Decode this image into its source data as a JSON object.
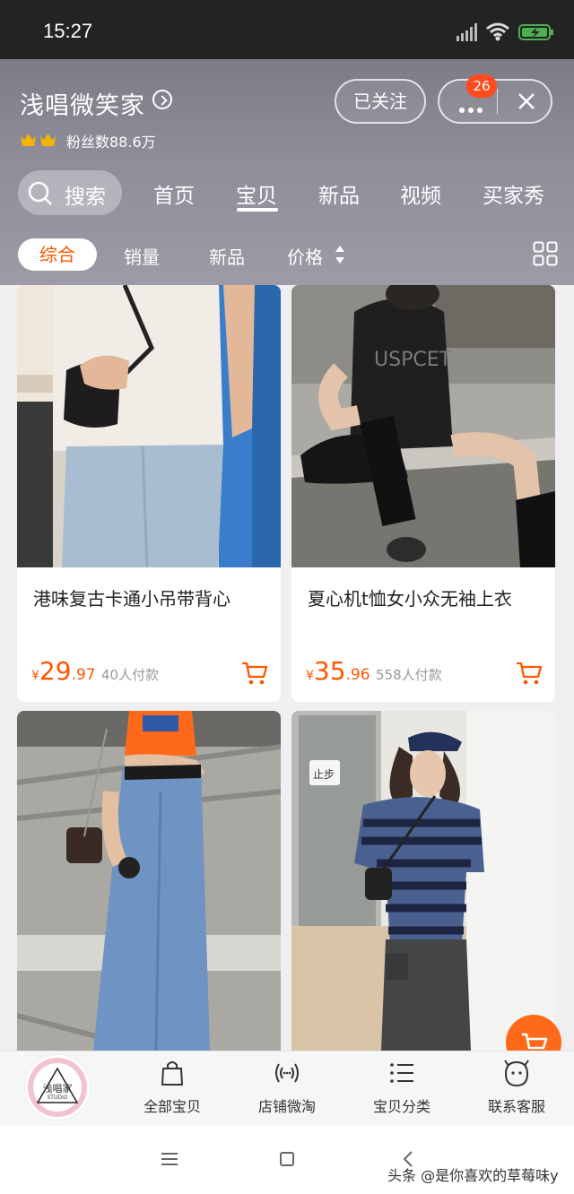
{
  "status_bar": {
    "time": "15:27"
  },
  "shop": {
    "name": "浅唱微笑家",
    "fans": "粉丝数88.6万",
    "follow_label": "已关注",
    "notification_count": "26"
  },
  "search": {
    "label": "搜索"
  },
  "tabs": [
    {
      "label": "首页"
    },
    {
      "label": "宝贝"
    },
    {
      "label": "新品"
    },
    {
      "label": "视频"
    },
    {
      "label": "买家秀"
    }
  ],
  "sort": {
    "active": "综合",
    "items": [
      "销量",
      "新品",
      "价格"
    ]
  },
  "products": [
    {
      "title": "港味复古卡通小吊带背心",
      "price_int": "29",
      "price_dec": ".97",
      "paid": "40人付款"
    },
    {
      "title": "夏心机t恤女小众无袖上衣",
      "price_int": "35",
      "price_dec": ".96",
      "paid": "558人付款"
    },
    {
      "title": "",
      "price_int": "",
      "price_dec": "",
      "paid": ""
    },
    {
      "title": "",
      "price_int": "",
      "price_dec": "",
      "paid": ""
    }
  ],
  "currency": "¥",
  "bottom_nav": {
    "logo_text": "浅唱家",
    "logo_sub": "STUDIO",
    "items": [
      {
        "label": "全部宝贝"
      },
      {
        "label": "店铺微淘"
      },
      {
        "label": "宝贝分类"
      },
      {
        "label": "联系客服"
      }
    ]
  },
  "watermark": "头条 @是你喜欢的草莓味y",
  "colors": {
    "accent": "#ff5500",
    "header": "#8f8d99"
  }
}
